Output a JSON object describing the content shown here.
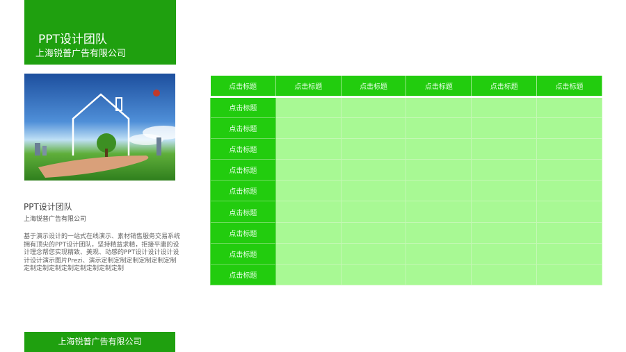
{
  "header": {
    "title": "PPT设计团队",
    "company": "上海锐普广告有限公司"
  },
  "info": {
    "name": "PPT设计团队",
    "company": "上海锐普广告有限公司",
    "description": "基于演示设计的一站式在线演示、素材销售服务交易系统拥有顶尖的PPT设计团队，坚持精益求精，拒接平庸的设计理念帮您实现精致、美观、动感的PPT设计设计设计设计设计演示图片Prezi、演示定制定制定制定制定制定制定制定制定制定制定制定制定制定制"
  },
  "footer": {
    "label": "上海锐普广告有限公司"
  },
  "table": {
    "headers": [
      "点击标题",
      "点击标题",
      "点击标题",
      "点击标题",
      "点击标题",
      "点击标题"
    ],
    "row_labels": [
      "点击标题",
      "点击标题",
      "点击标题",
      "点击标题",
      "点击标题",
      "点击标题",
      "点击标题",
      "点击标题",
      "点击标题"
    ]
  }
}
